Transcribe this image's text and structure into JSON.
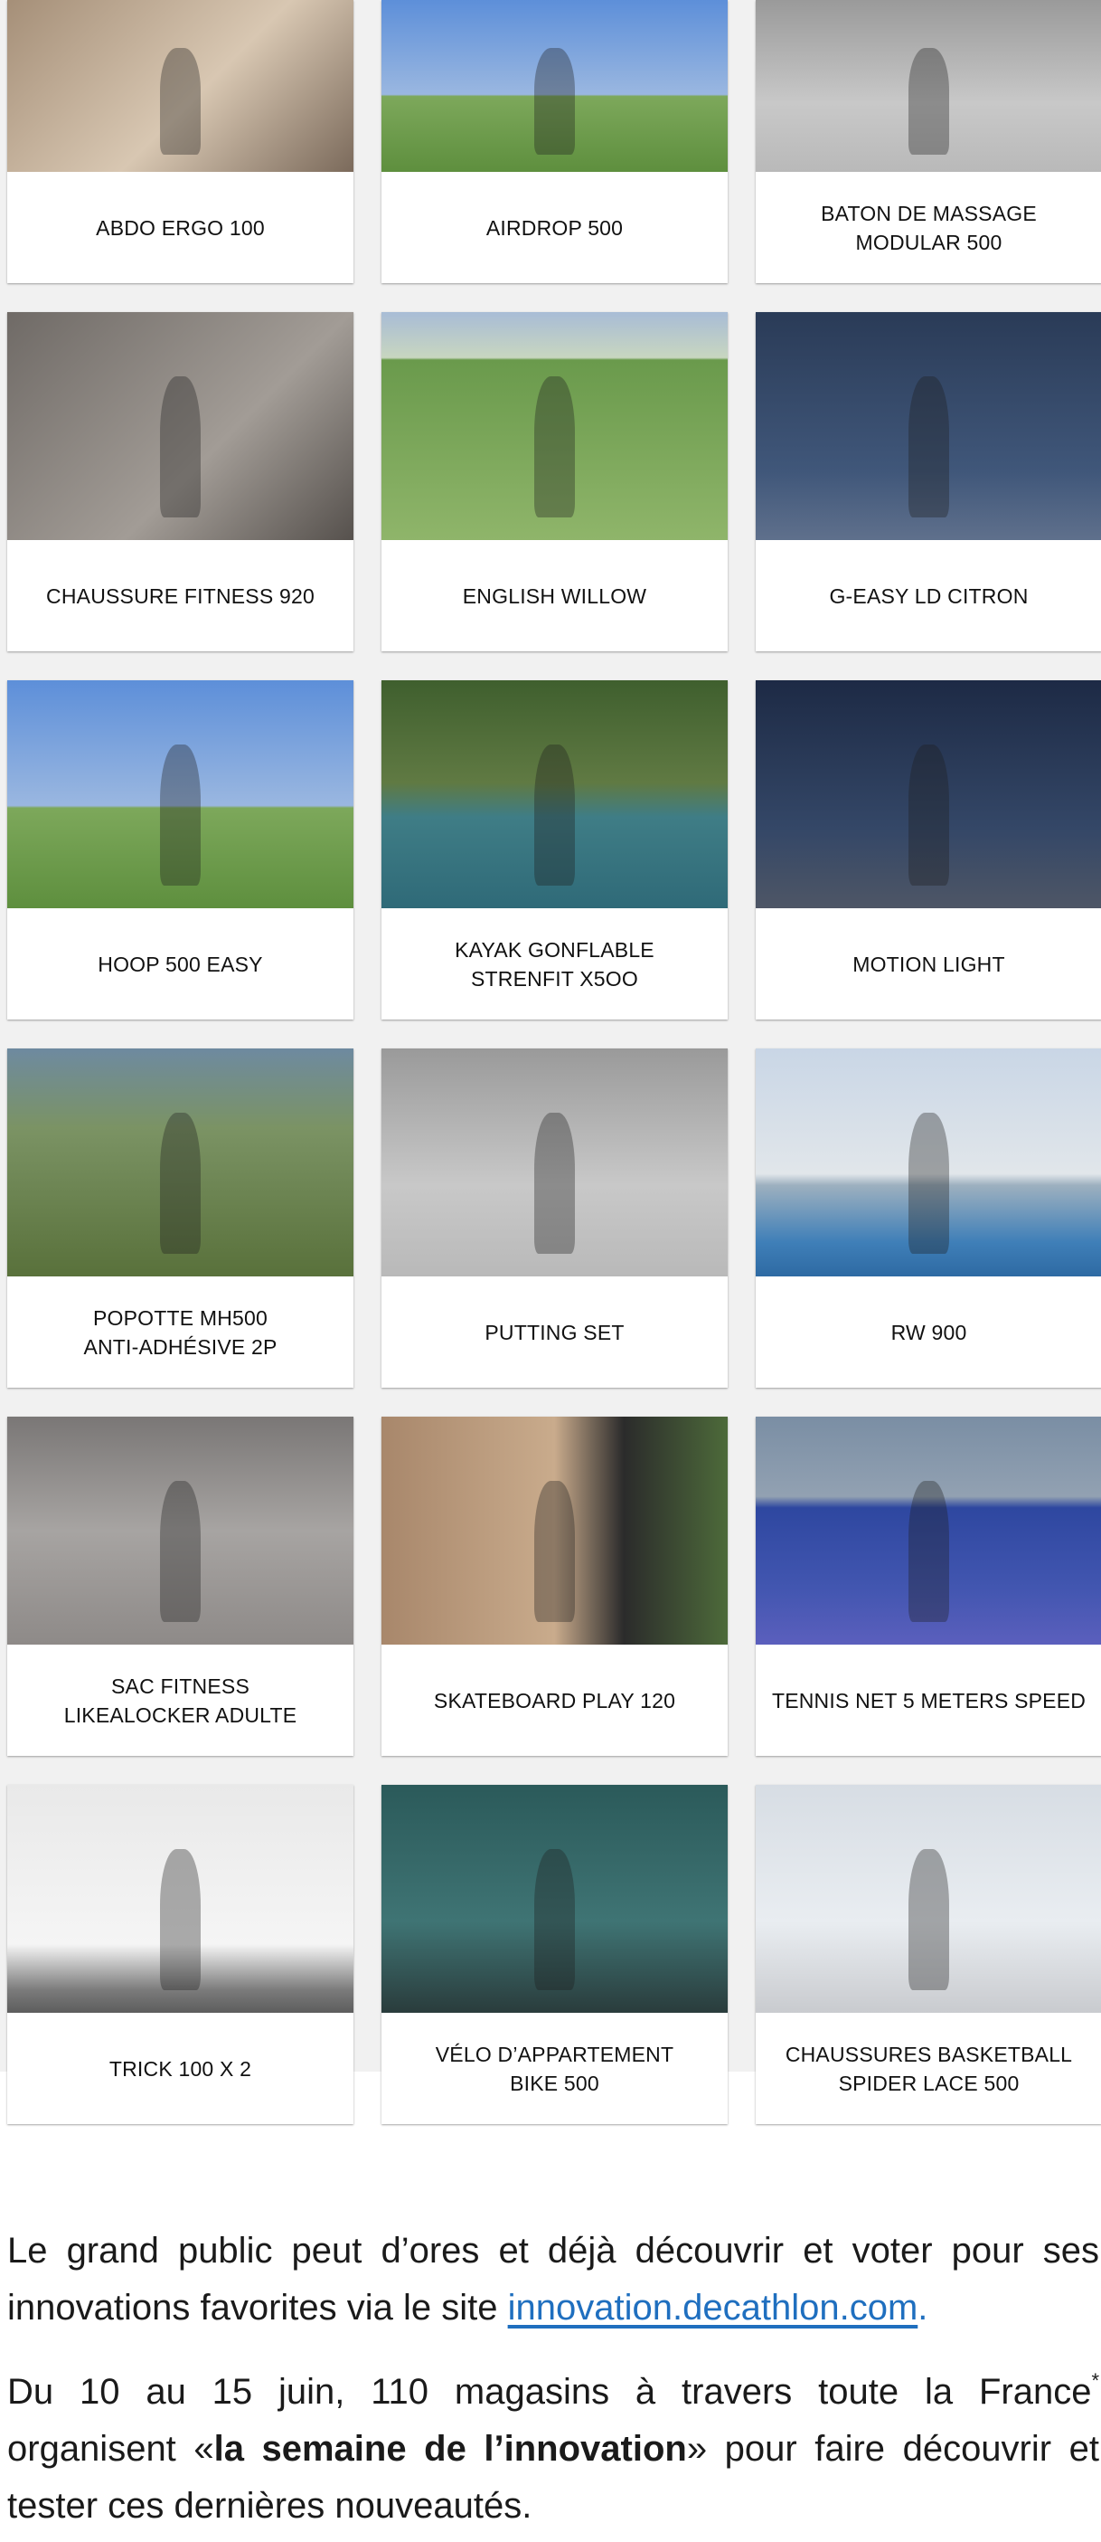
{
  "products": [
    {
      "name": "ABDO ERGO 100",
      "scene": "living"
    },
    {
      "name": "AIRDROP 500",
      "scene": "sky-blue"
    },
    {
      "name": "BATON DE MASSAGE\nMODULAR 500",
      "scene": "floor-gray"
    },
    {
      "name": "CHAUSSURE FITNESS 920",
      "scene": "gray-room"
    },
    {
      "name": "ENGLISH WILLOW",
      "scene": "field"
    },
    {
      "name": "G-EASY LD CITRON",
      "scene": "dark-blue"
    },
    {
      "name": "HOOP 500 EASY",
      "scene": "sky-blue"
    },
    {
      "name": "KAYAK GONFLABLE\nSTRENFIT X5OO",
      "scene": "green-water"
    },
    {
      "name": "MOTION LIGHT",
      "scene": "night"
    },
    {
      "name": "POPOTTE MH500\nANTI-ADHÉSIVE 2P",
      "scene": "forest"
    },
    {
      "name": "PUTTING SET",
      "scene": "floor-gray"
    },
    {
      "name": "RW 900",
      "scene": "stadium"
    },
    {
      "name": "SAC FITNESS\nLIKEALOCKER ADULTE",
      "scene": "studio-gray"
    },
    {
      "name": "SKATEBOARD PLAY 120",
      "scene": "wood-street"
    },
    {
      "name": "TENNIS NET 5 METERS SPEED",
      "scene": "court-blue"
    },
    {
      "name": "TRICK 100 X 2",
      "scene": "white-skate"
    },
    {
      "name": "VÉLO D’APPARTEMENT\nBIKE 500",
      "scene": "teal-room"
    },
    {
      "name": "CHAUSSURES BASKETBALL\nSPIDER LACE 500",
      "scene": "gym-white"
    }
  ],
  "paragraph1": {
    "text_before_link": "Le grand public peut d’ores et déjà découvrir et voter pour ses innovations favorites via le site ",
    "link_text": "innovation.decathlon.com",
    "text_after_link": "."
  },
  "paragraph2": {
    "text_start": "Du 10 au 15 juin, 110 magasins à travers toute la France",
    "footnote_mark": "*",
    "text_mid": " organisent «",
    "bold_text": "la semaine de l’innovation",
    "text_end": "» pour faire découvrir et tester ces dernières nouveautés."
  },
  "colors": {
    "link": "#1f6fbf",
    "grid_background": "#f1f1f1",
    "card_background": "#ffffff"
  }
}
